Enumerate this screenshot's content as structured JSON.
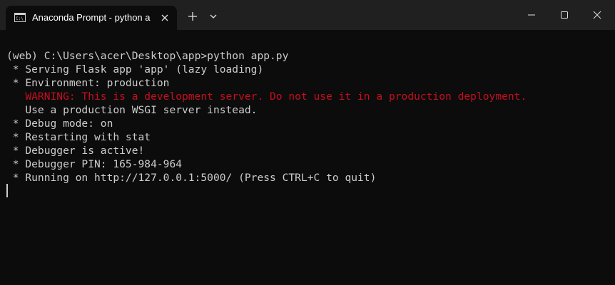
{
  "window": {
    "tab_title": "Anaconda Prompt - python  a"
  },
  "icons": {
    "tab_icon": "terminal-icon",
    "tab_close": "close-icon",
    "new_tab": "plus-icon",
    "dropdown": "chevron-down-icon",
    "minimize": "minimize-icon",
    "maximize": "maximize-icon",
    "close": "close-icon"
  },
  "colors": {
    "background": "#0c0c0c",
    "titlebar": "#202020",
    "text": "#cccccc",
    "warning": "#c50f1f"
  },
  "terminal": {
    "lines": [
      "(web) C:\\Users\\acer\\Desktop\\app>python app.py",
      " * Serving Flask app 'app' (lazy loading)",
      " * Environment: production",
      "   WARNING: This is a development server. Do not use it in a production deployment.",
      "   Use a production WSGI server instead.",
      " * Debug mode: on",
      " * Restarting with stat",
      " * Debugger is active!",
      " * Debugger PIN: 165-984-964",
      " * Running on http://127.0.0.1:5000/ (Press CTRL+C to quit)"
    ]
  }
}
